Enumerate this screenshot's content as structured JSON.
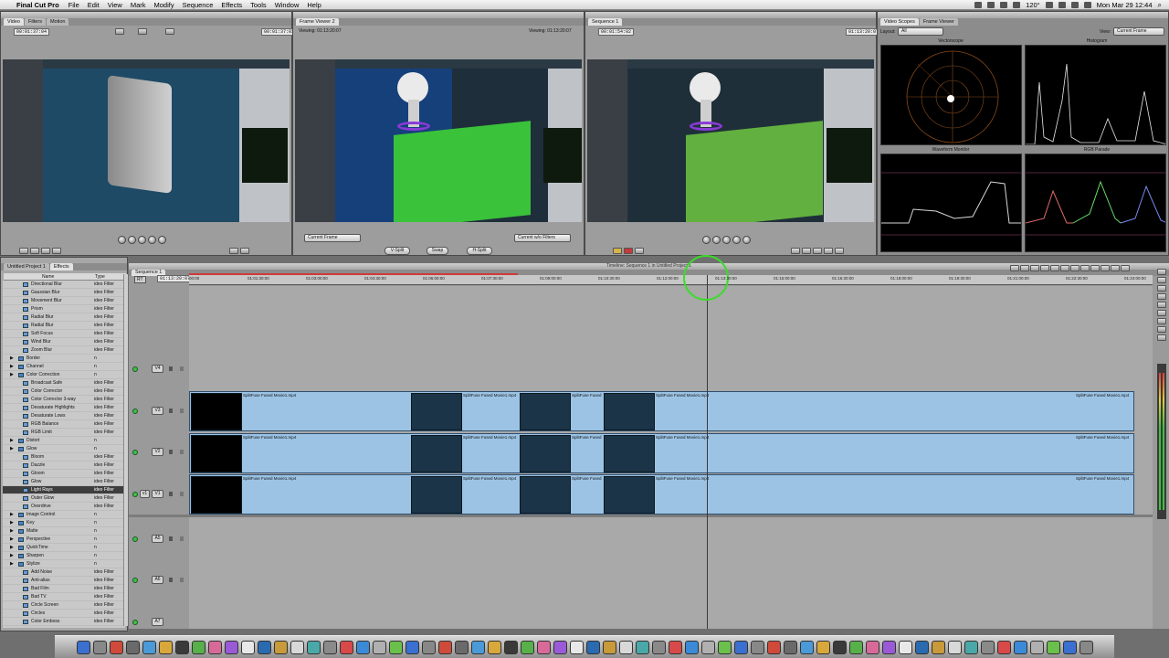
{
  "menubar": {
    "app_name": "Final Cut Pro",
    "menus": [
      "File",
      "Edit",
      "View",
      "Mark",
      "Modify",
      "Sequence",
      "Effects",
      "Tools",
      "Window",
      "Help"
    ],
    "temp": "120°",
    "clock": "Mon Mar 29  12:44"
  },
  "viewer": {
    "tabs": [
      "Video",
      "Filters",
      "Motion"
    ],
    "timecode_left": "00:01:37:04",
    "timecode_right": "00:01:37:03"
  },
  "frame_viewer": {
    "tab": "Frame Viewer 2",
    "viewing_left_label": "Viewing:",
    "viewing_left_tc": "01:13:20:07",
    "viewing_right_label": "Viewing:",
    "viewing_right_tc": "01:13:20:07",
    "left_select": "Current Frame",
    "right_select": "Current w/o Filters",
    "btn_vsplit": "V-Split",
    "btn_swap": "Swap",
    "btn_hsplit": "H-Split"
  },
  "canvas": {
    "tab": "Sequence 1",
    "timecode_left": "00:01:54:02",
    "timecode_right": "01:13:20:07"
  },
  "scopes": {
    "tabs": [
      "Video Scopes",
      "Frame Viewer"
    ],
    "layout_label": "Layout:",
    "layout_value": "All",
    "view_label": "View:",
    "view_value": "Current Frame",
    "vectorscope": "Vectorscope",
    "histogram": "Histogram",
    "waveform": "Waveform Monitor",
    "rgb_parade": "RGB Parade"
  },
  "browser": {
    "tabs": [
      "Untitled Project 1",
      "Effects"
    ],
    "col_name": "Name",
    "col_type": "Type",
    "items": [
      {
        "name": "Directional Blur",
        "type": "ideo Filter",
        "folder": false
      },
      {
        "name": "Gaussian Blur",
        "type": "ideo Filter",
        "folder": false
      },
      {
        "name": "Movement Blur",
        "type": "ideo Filter",
        "folder": false
      },
      {
        "name": "Prism",
        "type": "ideo Filter",
        "folder": false
      },
      {
        "name": "Radial Blur",
        "type": "ideo Filter",
        "folder": false
      },
      {
        "name": "Radial Blur",
        "type": "ideo Filter",
        "folder": false
      },
      {
        "name": "Soft Focus",
        "type": "ideo Filter",
        "folder": false
      },
      {
        "name": "Wind Blur",
        "type": "ideo Filter",
        "folder": false
      },
      {
        "name": "Zoom Blur",
        "type": "ideo Filter",
        "folder": false
      },
      {
        "name": "Border",
        "type": "n",
        "folder": true
      },
      {
        "name": "Channel",
        "type": "n",
        "folder": true
      },
      {
        "name": "Color Correction",
        "type": "n",
        "folder": true
      },
      {
        "name": "Broadcast Safe",
        "type": "ideo Filter",
        "folder": false
      },
      {
        "name": "Color Corrector",
        "type": "ideo Filter",
        "folder": false
      },
      {
        "name": "Color Corrector 3-way",
        "type": "ideo Filter",
        "folder": false
      },
      {
        "name": "Desaturate Highlights",
        "type": "ideo Filter",
        "folder": false
      },
      {
        "name": "Desaturate Lows",
        "type": "ideo Filter",
        "folder": false
      },
      {
        "name": "RGB Balance",
        "type": "ideo Filter",
        "folder": false
      },
      {
        "name": "RGB Limit",
        "type": "ideo Filter",
        "folder": false
      },
      {
        "name": "Distort",
        "type": "n",
        "folder": true
      },
      {
        "name": "Glow",
        "type": "n",
        "folder": true
      },
      {
        "name": "Bloom",
        "type": "ideo Filter",
        "folder": false
      },
      {
        "name": "Dazzle",
        "type": "ideo Filter",
        "folder": false
      },
      {
        "name": "Gloom",
        "type": "ideo Filter",
        "folder": false
      },
      {
        "name": "Glow",
        "type": "ideo Filter",
        "folder": false
      },
      {
        "name": "Light Rays",
        "type": "ideo Filter",
        "folder": false,
        "selected": true
      },
      {
        "name": "Outer Glow",
        "type": "ideo Filter",
        "folder": false
      },
      {
        "name": "Overdrive",
        "type": "ideo Filter",
        "folder": false
      },
      {
        "name": "Image Control",
        "type": "n",
        "folder": true
      },
      {
        "name": "Key",
        "type": "n",
        "folder": true
      },
      {
        "name": "Matte",
        "type": "n",
        "folder": true
      },
      {
        "name": "Perspective",
        "type": "n",
        "folder": true
      },
      {
        "name": "QuickTime",
        "type": "n",
        "folder": true
      },
      {
        "name": "Sharpen",
        "type": "n",
        "folder": true
      },
      {
        "name": "Stylize",
        "type": "n",
        "folder": true
      },
      {
        "name": "Add Noise",
        "type": "ideo Filter",
        "folder": false
      },
      {
        "name": "Anti-alias",
        "type": "ideo Filter",
        "folder": false
      },
      {
        "name": "Bad Film",
        "type": "ideo Filter",
        "folder": false
      },
      {
        "name": "Bad TV",
        "type": "ideo Filter",
        "folder": false
      },
      {
        "name": "Circle Screen",
        "type": "ideo Filter",
        "folder": false
      },
      {
        "name": "Circles",
        "type": "ideo Filter",
        "folder": false
      },
      {
        "name": "Color Emboss",
        "type": "ideo Filter",
        "folder": false
      }
    ]
  },
  "timeline": {
    "title": "Timeline: Sequence 1 in Untitled Project 1",
    "tab": "Sequence 1",
    "rt": "RT",
    "current_tc": "01:13:20:07",
    "ruler": [
      "00:00",
      "01:01:30:00",
      "01:03:00:00",
      "01:04:30:00",
      "01:06:00:00",
      "01:07:30:00",
      "01:09:00:00",
      "01:10:30:00",
      "01:12:00:00",
      "01:13:30:00",
      "01:15:00:00",
      "01:16:30:00",
      "01:18:00:00",
      "01:19:30:00",
      "01:21:00:00",
      "01:22:30:00",
      "01:24:00:00"
    ],
    "tracks": {
      "v4": "V4",
      "v3": "V3",
      "v2": "V2",
      "v1": "V1",
      "v1src": "v1",
      "a5": "A5",
      "a6": "A6",
      "a7": "A7"
    },
    "clip_name": "SplitFuse Fused Movie1.mp4",
    "clip_short": "SplitFuse Fused"
  }
}
